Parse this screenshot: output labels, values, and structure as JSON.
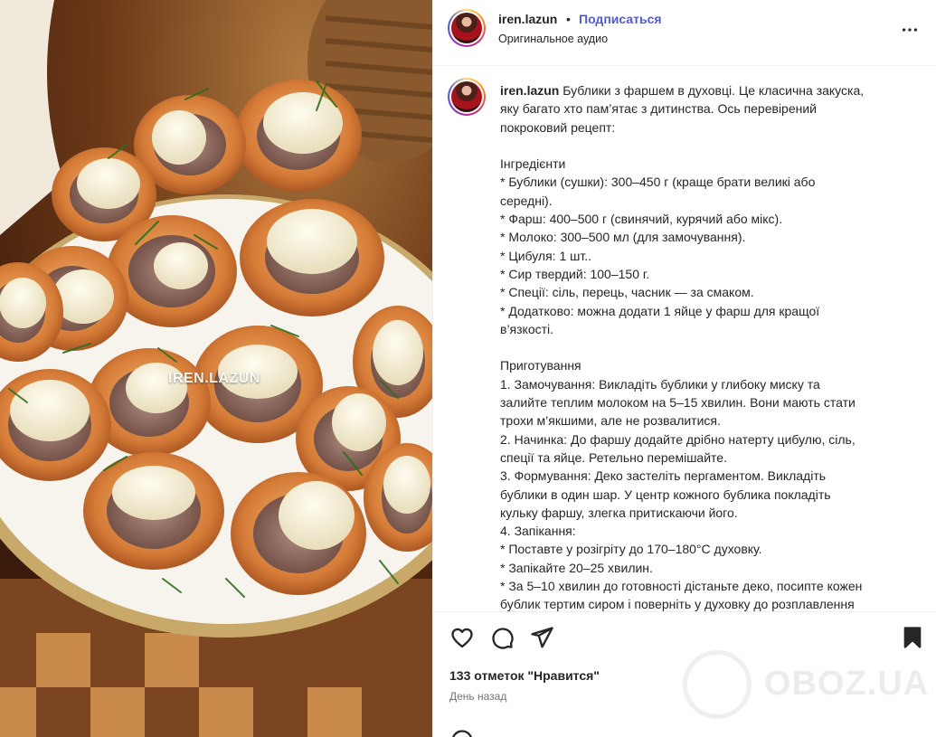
{
  "media": {
    "watermark": "IREN.LAZUN"
  },
  "header": {
    "username": "iren.lazun",
    "separator": "•",
    "follow_label": "Подписаться",
    "audio_label": "Оригинальное аудио",
    "more_icon": "more-horizontal-icon"
  },
  "caption": {
    "username": "iren.lazun",
    "lines": [
      "Бублики з фаршем в духовці. Це класична закуска,",
      "яку багато хто пам’ятає з дитинства. Ось перевірений",
      "покроковий рецепт:",
      "",
      "Інгредієнти",
      "* Бублики (сушки): 300–450 г (краще брати великі або",
      "середні).",
      "* Фарш: 400–500 г (свинячий, курячий або мікс).",
      "* Молоко: 300–500 мл (для замочування).",
      "* Цибуля: 1 шт..",
      "* Сир твердий: 100–150 г.",
      "* Спеції: сіль, перець, часник — за смаком.",
      "* Додатково: можна додати 1 яйце у фарш для кращої",
      "в’язкості.",
      "",
      "Приготування",
      "1. Замочування: Викладіть бублики у глибоку миску та",
      "залийте теплим молоком на 5–15 хвилин. Вони мають стати",
      "трохи м’якшими, але не розвалитися.",
      "2. Начинка: До фаршу додайте дрібно натерту цибулю, сіль,",
      "спеції та яйце. Ретельно перемішайте.",
      "3. Формування: Деко застеліть пергаментом. Викладіть",
      "бублики в один шар. У центр кожного бублика покладіть",
      "кульку фаршу, злегка притискаючи його.",
      "4. Запікання:",
      "* Поставте у розігріту до 170–180°C духовку.",
      "* Запікайте 20–25 хвилин.",
      "* За 5–10 хвилин до готовності дістаньте деко, посипте кожен",
      "бублик тертим сиром і поверніть у духовку до розплавлення"
    ]
  },
  "actions": {
    "like_icon": "heart-icon",
    "comment_icon": "comment-icon",
    "share_icon": "send-icon",
    "save_icon": "bookmark-icon",
    "likes_text": "133 отметок \"Нравится\"",
    "time_text": "День назад"
  },
  "brand_watermark": {
    "text": "OBOZ.UA"
  },
  "colors": {
    "follow": "#4f5bd5",
    "text": "#262626",
    "muted": "#737373",
    "border": "#efefef"
  }
}
